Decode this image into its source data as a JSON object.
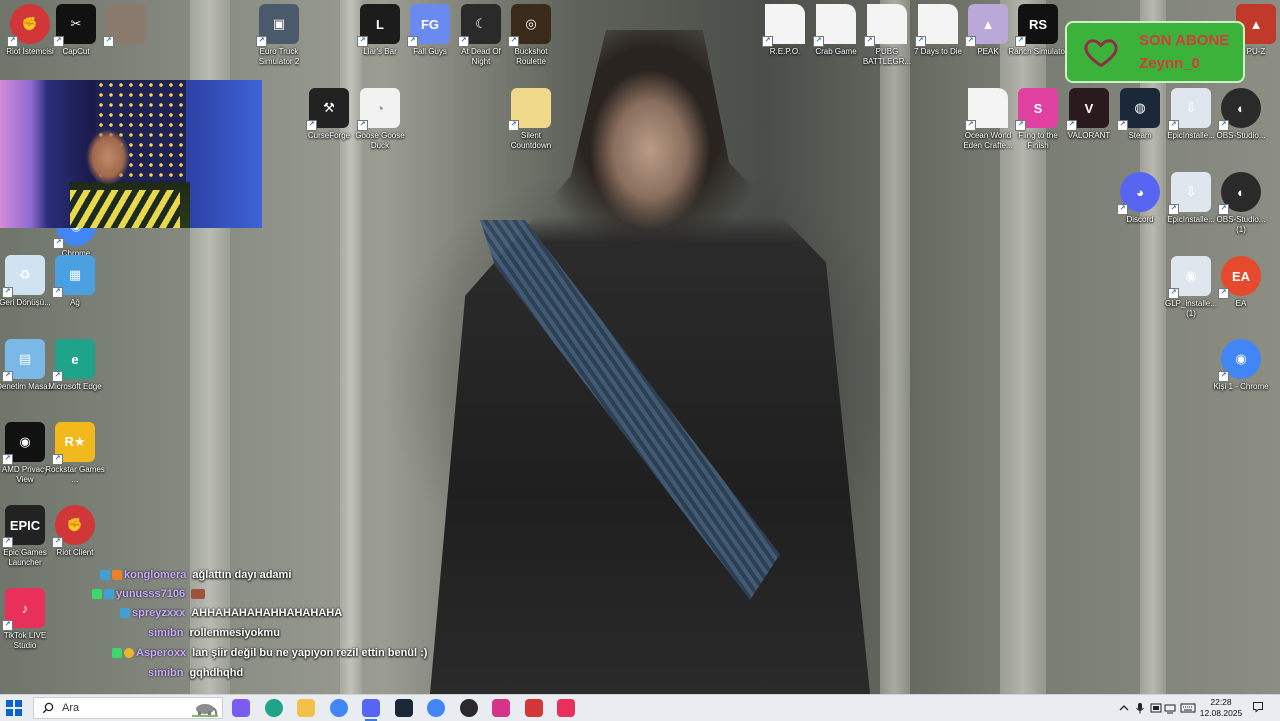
{
  "desktop_icons": [
    {
      "id": "riot-istemcisi",
      "label": "Riot İstemcisi",
      "icon": "riot-icon",
      "color": "#d13639"
    },
    {
      "id": "capcut",
      "label": "CapCut",
      "icon": "capcut-icon",
      "color": "#111111"
    },
    {
      "id": "photo",
      "label": "",
      "icon": "photo-icon",
      "color": "#8a7a6e"
    },
    {
      "id": "chrome-cam",
      "label": "Chrome",
      "icon": "chrome-icon",
      "color": "#4285f4"
    },
    {
      "id": "euro-truck",
      "label": "Euro Truck Simulator 2",
      "icon": "truck-icon",
      "color": "#4a5a6a"
    },
    {
      "id": "liars-bar",
      "label": "Liar's Bar",
      "icon": "liars-bar-icon",
      "color": "#1c1c1c"
    },
    {
      "id": "fall-guys",
      "label": "Fall Guys",
      "icon": "fall-guys-icon",
      "color": "#6a8af0"
    },
    {
      "id": "dead-of-night",
      "label": "At Dead Of Night",
      "icon": "dead-of-night-icon",
      "color": "#2a2a2a"
    },
    {
      "id": "buckshot",
      "label": "Buckshot Roulette",
      "icon": "buckshot-icon",
      "color": "#3a2a1a"
    },
    {
      "id": "curseforge",
      "label": "CurseForge",
      "icon": "curseforge-icon",
      "color": "#222222"
    },
    {
      "id": "goose",
      "label": "Goose Goose Duck",
      "icon": "goose-icon",
      "color": "#f2f2f2"
    },
    {
      "id": "silent-countdown",
      "label": "Silent Countdown",
      "icon": "folder-icon",
      "color": "#f0d98a"
    },
    {
      "id": "repo",
      "label": "R.E.P.O.",
      "icon": "file-icon",
      "color": "#f4f4f4"
    },
    {
      "id": "crab-game",
      "label": "Crab Game",
      "icon": "file-icon",
      "color": "#f4f4f4"
    },
    {
      "id": "pubg",
      "label": "PUBG BATTLEGR...",
      "icon": "file-icon",
      "color": "#f4f4f4"
    },
    {
      "id": "7-days",
      "label": "7 Days to Die",
      "icon": "file-icon",
      "color": "#f4f4f4"
    },
    {
      "id": "peak",
      "label": "PEAK",
      "icon": "peak-icon",
      "color": "#b9a8d8"
    },
    {
      "id": "ranch",
      "label": "Ranch Simulator",
      "icon": "ranch-icon",
      "color": "#111111"
    },
    {
      "id": "ocean-world",
      "label": "Ocean World Eden Crafte...",
      "icon": "file-icon",
      "color": "#f4f4f4"
    },
    {
      "id": "fling",
      "label": "Fling to the Finish",
      "icon": "fling-icon",
      "color": "#e040a0"
    },
    {
      "id": "valorant",
      "label": "VALORANT",
      "icon": "valorant-icon",
      "color": "#2a1a1e"
    },
    {
      "id": "steam",
      "label": "Steam",
      "icon": "steam-icon",
      "color": "#1b2838"
    },
    {
      "id": "epic-installer-1",
      "label": "EpicInstalle...",
      "icon": "installer-icon",
      "color": "#dfe6ee"
    },
    {
      "id": "obs-1",
      "label": "OBS-Studio...",
      "icon": "obs-icon",
      "color": "#2a2a2a"
    },
    {
      "id": "discord",
      "label": "Discord",
      "icon": "discord-icon",
      "color": "#5865f2"
    },
    {
      "id": "epic-installer-2",
      "label": "EpicInstalle...",
      "icon": "installer-icon",
      "color": "#dfe6ee"
    },
    {
      "id": "obs-2",
      "label": "OBS-Studio... (1)",
      "icon": "obs-icon",
      "color": "#2a2a2a"
    },
    {
      "id": "glp-installer",
      "label": "GLP_installe... (1)",
      "icon": "glp-icon",
      "color": "#dfe6ee"
    },
    {
      "id": "ea",
      "label": "EA",
      "icon": "ea-icon",
      "color": "#e64a2e"
    },
    {
      "id": "kisi-chrome",
      "label": "Kişi 1 - Chrome",
      "icon": "chrome-icon",
      "color": "#4285f4"
    },
    {
      "id": "geri-donusum",
      "label": "Geri Dönüşü...",
      "icon": "recycle-bin-icon",
      "color": "#cfe3f2"
    },
    {
      "id": "ag",
      "label": "Ağ",
      "icon": "network-icon",
      "color": "#4aa0e0"
    },
    {
      "id": "denetim",
      "label": "Denetim Masası",
      "icon": "control-panel-icon",
      "color": "#7ab8e8"
    },
    {
      "id": "edge",
      "label": "Microsoft Edge",
      "icon": "edge-icon",
      "color": "#1fa38a"
    },
    {
      "id": "amd",
      "label": "AMD Privacy View",
      "icon": "amd-icon",
      "color": "#111111"
    },
    {
      "id": "rockstar",
      "label": "Rockstar Games ...",
      "icon": "rockstar-icon",
      "color": "#f2b81c"
    },
    {
      "id": "epic-launcher",
      "label": "Epic Games Launcher",
      "icon": "epic-games-icon",
      "color": "#222222"
    },
    {
      "id": "riot-client",
      "label": "Riot Client",
      "icon": "riot-icon",
      "color": "#d13639"
    },
    {
      "id": "tiktok-live",
      "label": "TikTok LIVE Studio",
      "icon": "tiktok-icon",
      "color": "#e8305a"
    },
    {
      "id": "pu-z",
      "label": "PU-Z",
      "icon": "app-icon",
      "color": "#c0392b"
    }
  ],
  "subscriber_alert": {
    "title": "SON ABONE",
    "name": "Zeynn_0",
    "bg": "#3bb33b",
    "text_color": "#d63b3b"
  },
  "chat": [
    {
      "user": "konglomera",
      "message": "ağlattın dayı adami"
    },
    {
      "user": "yunusss7106",
      "message": ""
    },
    {
      "user": "spreyzxxx",
      "message": "AHHAHAHAHAHHAHAHAHA"
    },
    {
      "user": "simibn",
      "message": "rollenmesiyokmu"
    },
    {
      "user": "Asperoxx",
      "message": "lan şiir değil bu ne yapıyon rezil ettin benül :)"
    },
    {
      "user": "simibn",
      "message": "gqhdhqhd"
    }
  ],
  "taskbar": {
    "search_placeholder": "Ara",
    "apps": [
      {
        "name": "copilot-icon",
        "color": "#7c5cf0"
      },
      {
        "name": "edge-icon",
        "color": "#1fa38a"
      },
      {
        "name": "file-explorer-icon",
        "color": "#f2c14a"
      },
      {
        "name": "chrome-icon",
        "color": "#4285f4"
      },
      {
        "name": "discord-icon",
        "color": "#5865f2"
      },
      {
        "name": "steam-icon",
        "color": "#1b2838"
      },
      {
        "name": "chrome-icon",
        "color": "#4285f4"
      },
      {
        "name": "obs-icon",
        "color": "#2a2a2a"
      },
      {
        "name": "instagram-icon",
        "color": "#d6338a"
      },
      {
        "name": "riot-icon",
        "color": "#d13639"
      },
      {
        "name": "tiktok-icon",
        "color": "#e8305a"
      }
    ],
    "time": "22:28",
    "date": "12.08.2025"
  }
}
